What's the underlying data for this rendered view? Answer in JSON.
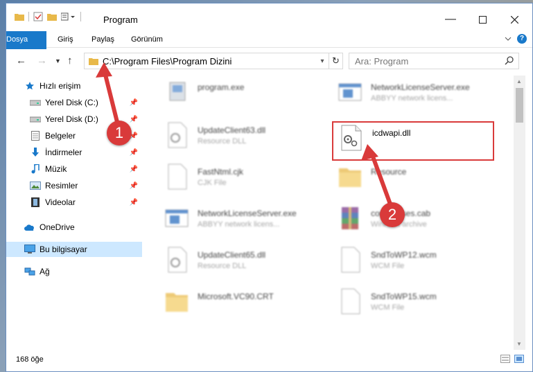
{
  "window": {
    "title": "Program"
  },
  "ribbon": {
    "tabs": [
      "Dosya",
      "Giriş",
      "Paylaş",
      "Görünüm"
    ],
    "help": "?"
  },
  "address": {
    "path": "C:\\Program Files\\Program Dizini",
    "search_placeholder": "Ara: Program"
  },
  "nav": {
    "items": [
      {
        "label": "Hızlı erişim",
        "icon": "star-icon",
        "pinned": false
      },
      {
        "label": "Yerel Disk (C:)",
        "icon": "drive-icon",
        "pinned": true
      },
      {
        "label": "Yerel Disk (D:)",
        "icon": "drive-icon",
        "pinned": true
      },
      {
        "label": "Belgeler",
        "icon": "documents-icon",
        "pinned": true
      },
      {
        "label": "İndirmeler",
        "icon": "download-icon",
        "pinned": true
      },
      {
        "label": "Müzik",
        "icon": "music-icon",
        "pinned": true
      },
      {
        "label": "Resimler",
        "icon": "pictures-icon",
        "pinned": true
      },
      {
        "label": "Videolar",
        "icon": "video-icon",
        "pinned": true
      },
      {
        "label": "OneDrive",
        "icon": "cloud-icon",
        "pinned": false
      },
      {
        "label": "Bu bilgisayar",
        "icon": "computer-icon",
        "pinned": false
      },
      {
        "label": "Ağ",
        "icon": "network-icon",
        "pinned": false
      }
    ]
  },
  "files": [
    {
      "name": "program.exe",
      "type": "",
      "icon": "app-icon"
    },
    {
      "name": "NetworkLicenseServer.exe",
      "type": "ABBYY network licens...",
      "icon": "window-icon"
    },
    {
      "name": "UpdateClient63.dll",
      "type": "Resource DLL",
      "icon": "gear-file-icon"
    },
    {
      "name": "icdwapi.dll",
      "type": "",
      "icon": "gear-file-icon"
    },
    {
      "name": "FastNtml.cjk",
      "type": "CJK File",
      "icon": "blank-file-icon"
    },
    {
      "name": "Resource",
      "type": "",
      "icon": "folder-icon"
    },
    {
      "name": "NetworkLicenseServer.exe",
      "type": "ABBYY network licens...",
      "icon": "window-icon"
    },
    {
      "name": "coreclasses.cab",
      "type": "WinRAR archive",
      "icon": "archive-icon"
    },
    {
      "name": "UpdateClient65.dll",
      "type": "Resource DLL",
      "icon": "gear-file-icon"
    },
    {
      "name": "SndToWP12.wcm",
      "type": "WCM File",
      "icon": "blank-file-icon"
    },
    {
      "name": "Microsoft.VC90.CRT",
      "type": "",
      "icon": "folder-icon"
    },
    {
      "name": "SndToWP15.wcm",
      "type": "WCM File",
      "icon": "blank-file-icon"
    }
  ],
  "status": {
    "count": "168 öğe"
  },
  "annotations": {
    "step1": "1",
    "step2": "2"
  },
  "colors": {
    "accent": "#1979ca",
    "highlight": "#d93a3a",
    "selected": "#cde8ff"
  }
}
